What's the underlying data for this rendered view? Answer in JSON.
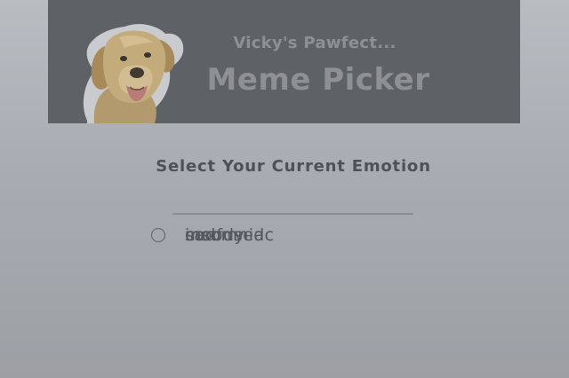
{
  "banner": {
    "subtitle": "Vicky's Pawfect...",
    "title": "Meme Picker",
    "logo_icon": "dog-photo-icon"
  },
  "heading": "Select Your Current Emotion",
  "options": [
    {
      "label": "moody",
      "selected": false
    },
    {
      "label": "insomniac",
      "selected": false
    },
    {
      "label": "confused",
      "selected": false
    },
    {
      "label": "sad",
      "selected": false
    }
  ],
  "colors": {
    "banner_bg": "#5e6166",
    "banner_text": "#8e9095",
    "heading_text": "#4e5157",
    "option_border": "#8a8d92"
  }
}
